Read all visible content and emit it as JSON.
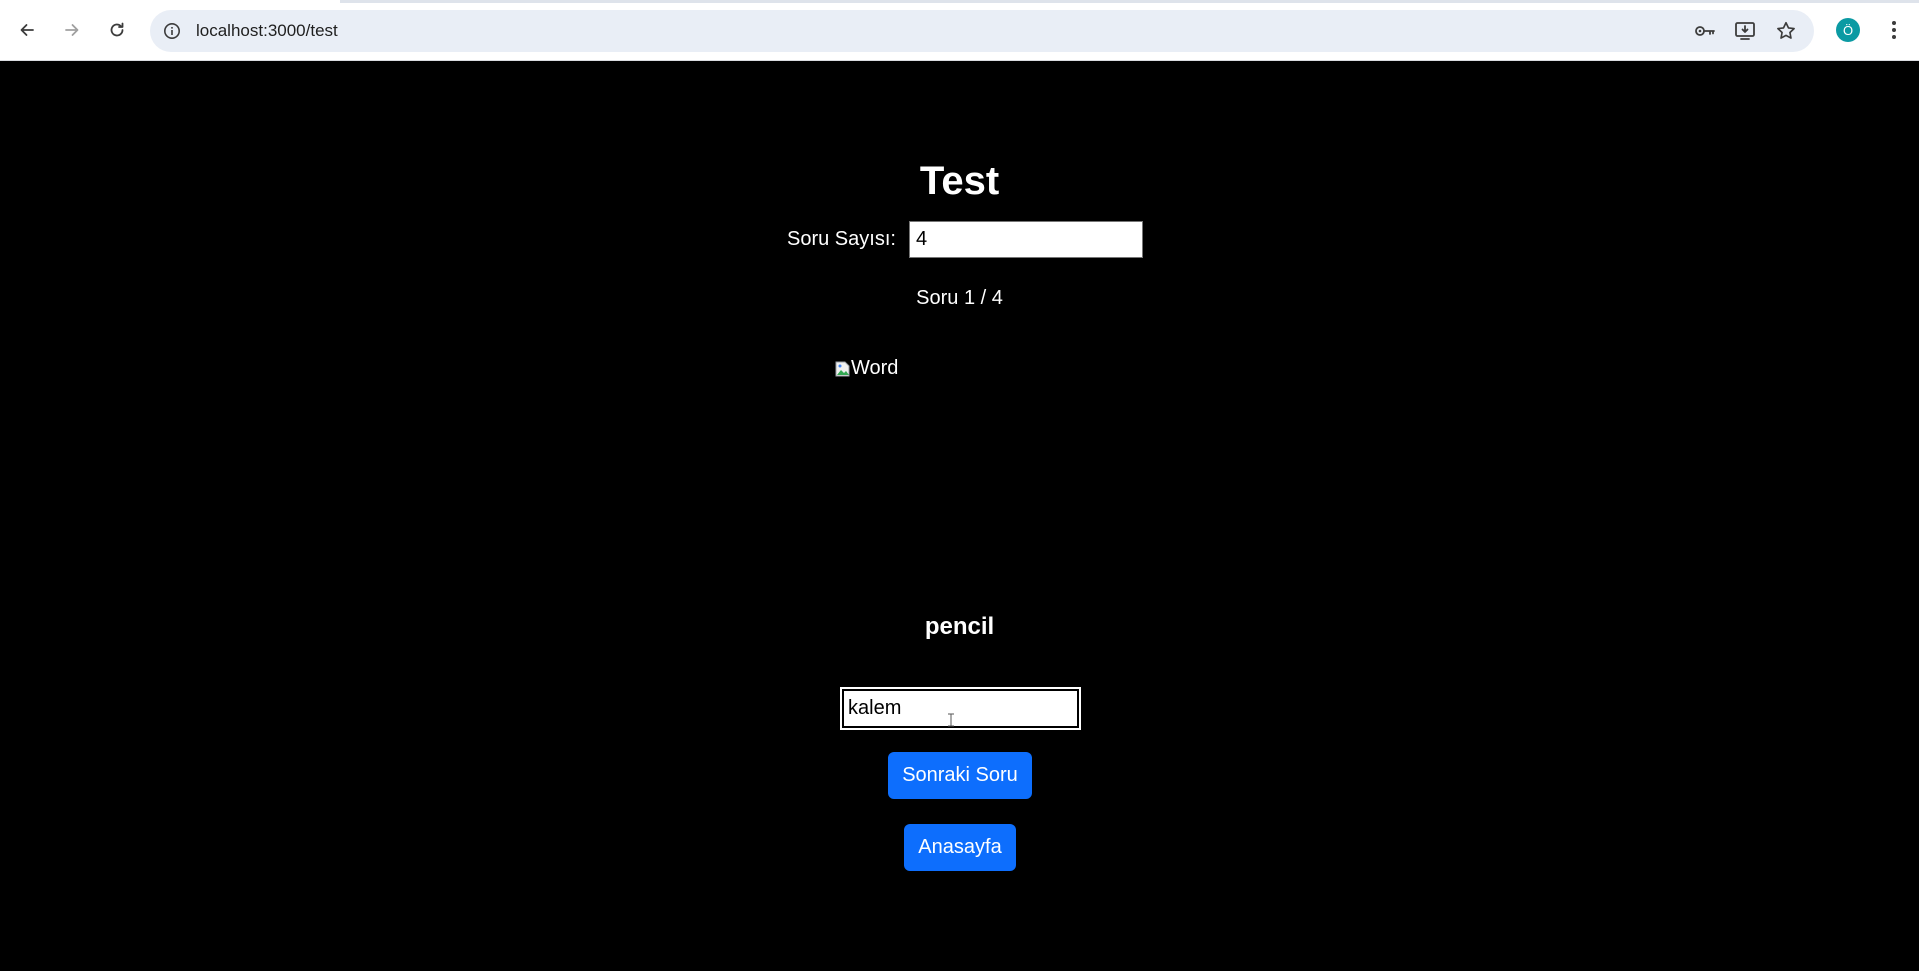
{
  "browser": {
    "url": "localhost:3000/test",
    "profile_initial": "Ö",
    "icons": {
      "back": "back-arrow-icon",
      "forward": "forward-arrow-icon",
      "reload": "reload-icon",
      "site_info": "info-icon",
      "password": "key-icon",
      "install": "install-app-icon",
      "bookmark": "star-icon",
      "menu": "kebab-menu-icon"
    }
  },
  "page": {
    "title": "Test",
    "question_count_label": "Soru Sayısı:",
    "question_count_value": "4",
    "progress": "Soru 1 / 4",
    "image_alt": "Word",
    "word": "pencil",
    "answer_value": "kalem",
    "next_button": "Sonraki Soru",
    "home_button": "Anasayfa"
  },
  "colors": {
    "page_background": "#000000",
    "button_primary": "#0d6efd",
    "avatar": "#0b9aa3"
  }
}
